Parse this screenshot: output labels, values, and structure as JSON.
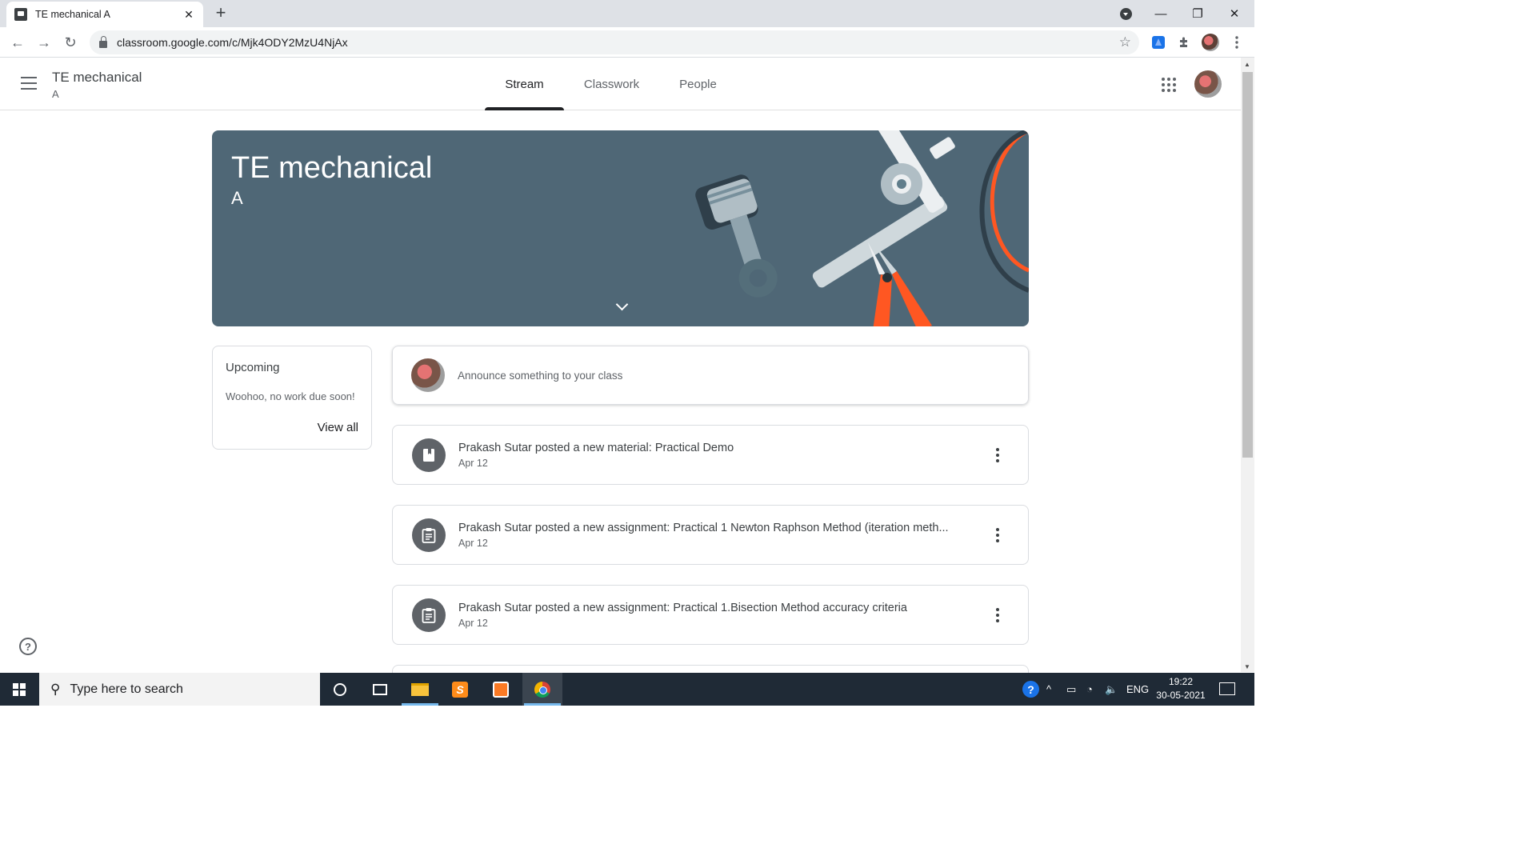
{
  "browser": {
    "tab_title": "TE mechanical A",
    "url": "classroom.google.com/c/Mjk4ODY2MzU4NjAx"
  },
  "appbar": {
    "class_name": "TE mechanical",
    "section": "A",
    "tabs": [
      {
        "label": "Stream",
        "active": true
      },
      {
        "label": "Classwork",
        "active": false
      },
      {
        "label": "People",
        "active": false
      }
    ]
  },
  "banner": {
    "title": "TE mechanical",
    "section": "A",
    "theme_color": "#4f6776"
  },
  "upcoming": {
    "heading": "Upcoming",
    "message": "Woohoo, no work due soon!",
    "view_all": "View all"
  },
  "announce": {
    "placeholder": "Announce something to your class"
  },
  "stream": [
    {
      "icon": "material-icon",
      "title": "Prakash Sutar posted a new material: Practical Demo",
      "date": "Apr 12"
    },
    {
      "icon": "assignment-icon",
      "title": "Prakash Sutar posted a new assignment: Practical 1 Newton Raphson Method (iteration meth...",
      "date": "Apr 12"
    },
    {
      "icon": "assignment-icon",
      "title": "Prakash Sutar posted a new assignment: Practical 1.Bisection Method accuracy criteria",
      "date": "Apr 12"
    }
  ],
  "taskbar": {
    "search_placeholder": "Type here to search",
    "language": "ENG",
    "time": "19:22",
    "date": "30-05-2021"
  }
}
